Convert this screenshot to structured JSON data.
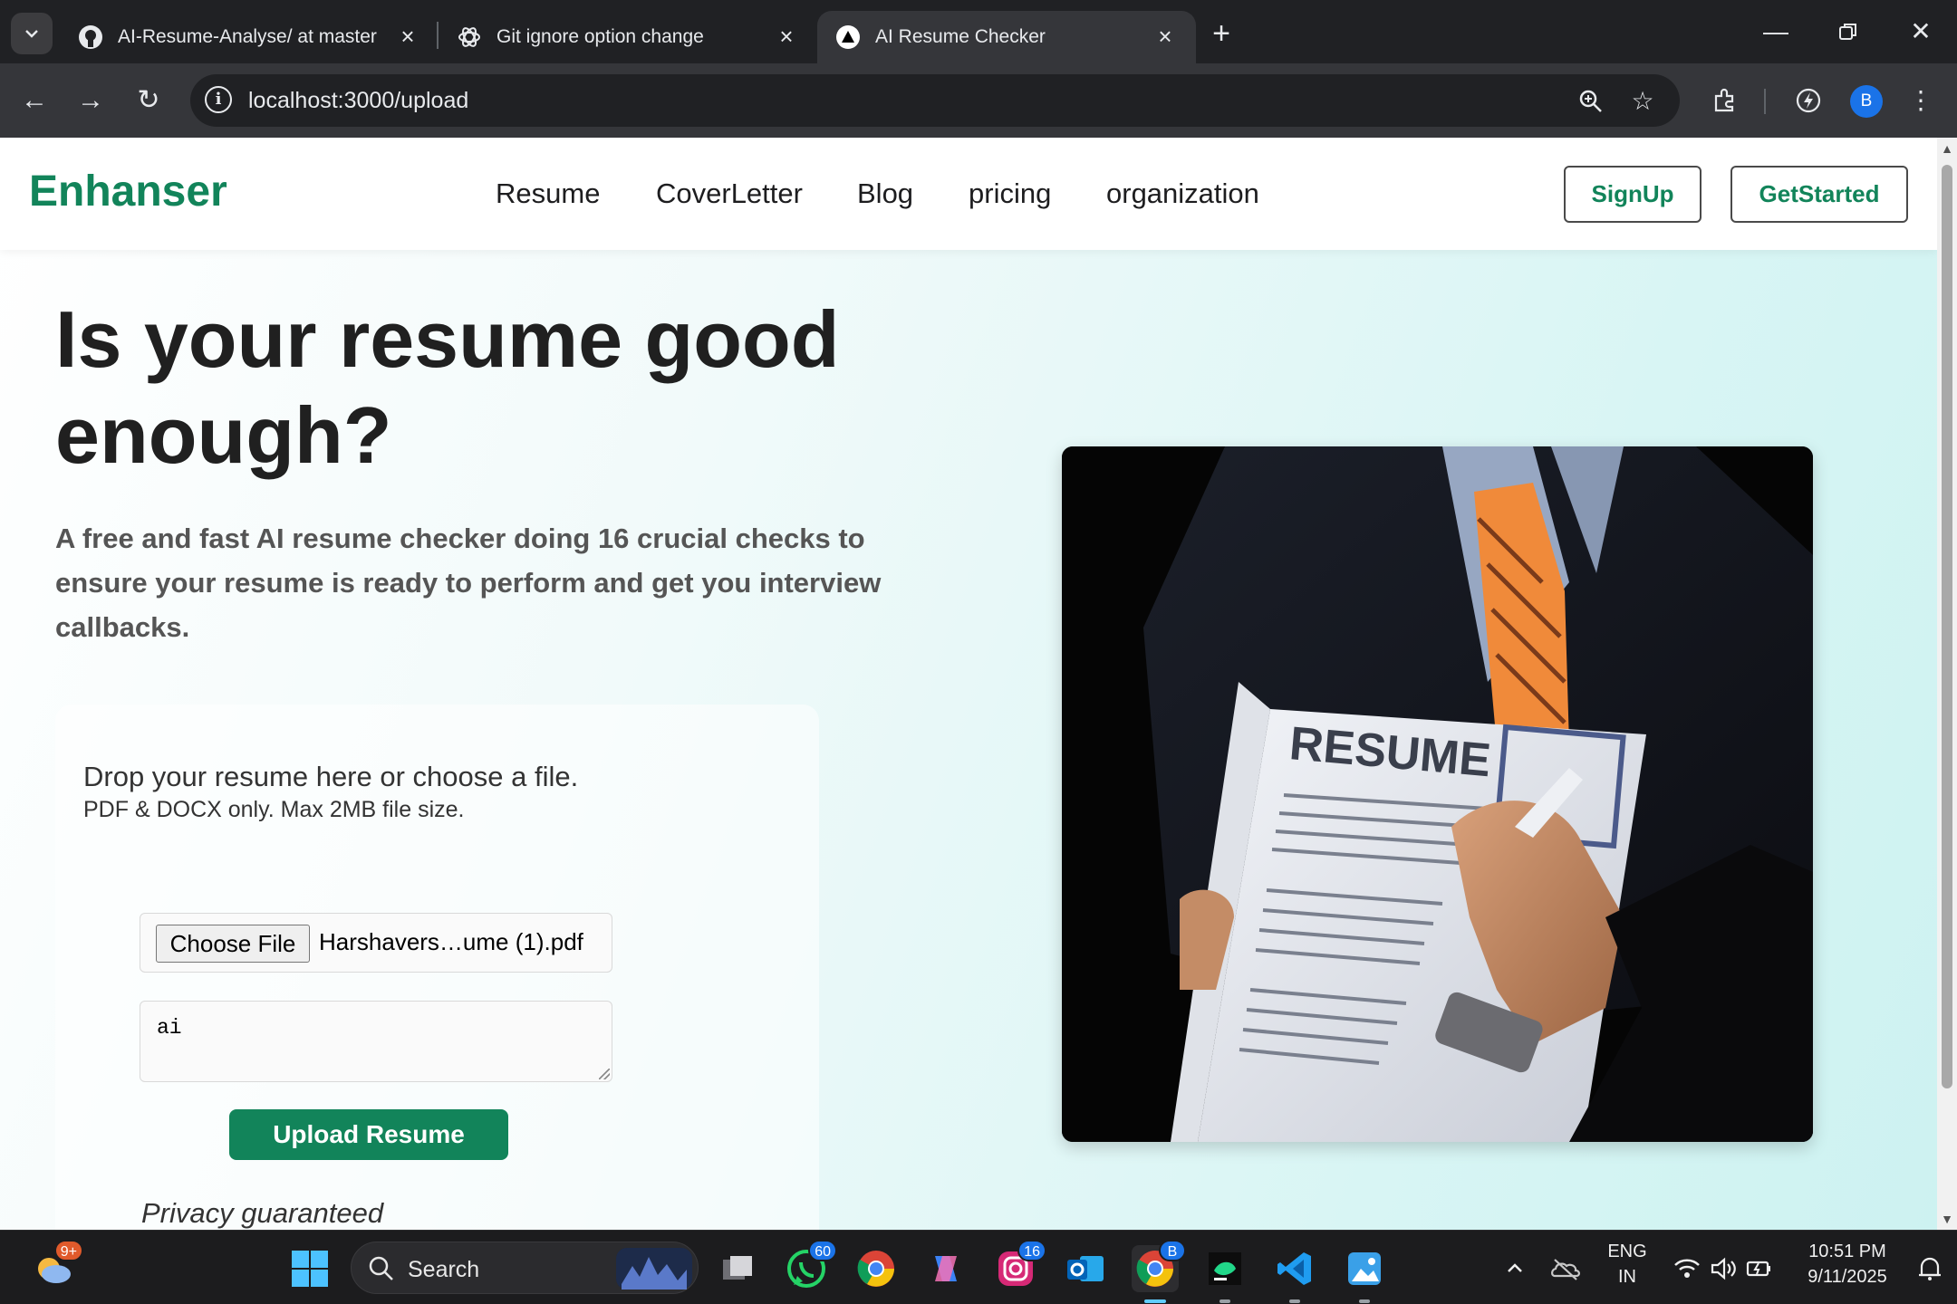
{
  "browser": {
    "tabs": [
      {
        "title": "AI-Resume-Analyse/ at master",
        "icon": "github-icon"
      },
      {
        "title": "Git ignore option change",
        "icon": "chatgpt-icon"
      },
      {
        "title": "AI Resume Checker",
        "icon": "app-triangle-icon",
        "active": true
      }
    ],
    "url": "localhost:3000/upload",
    "profile_initial": "B"
  },
  "site": {
    "brand": "Enhanser",
    "brand_color": "#12845a",
    "nav": [
      "Resume",
      "CoverLetter",
      "Blog",
      "pricing",
      "organization"
    ],
    "signup_label": "SignUp",
    "get_started_label": "GetStarted",
    "hero_title": "Is your resume good enough?",
    "hero_subtitle": "A free and fast AI resume checker doing 16 crucial checks to ensure your resume is ready to perform and get you interview callbacks.",
    "upload": {
      "drop_title": "Drop your resume here or choose a file.",
      "drop_note": "PDF & DOCX only. Max 2MB file size.",
      "choose_file_label": "Choose File",
      "file_name": "Harshavers…ume (1).pdf",
      "textarea_value": "ai",
      "upload_button": "Upload Resume",
      "privacy_text": "Privacy guaranteed"
    },
    "image_text": "RESUME"
  },
  "taskbar": {
    "search_placeholder": "Search",
    "notifications_badge": "9+",
    "whatsapp_badge": "60",
    "instagram_badge": "16",
    "chrome_profile_badge": "B",
    "language": "ENG",
    "region": "IN",
    "time": "10:51 PM",
    "date": "9/11/2025"
  }
}
